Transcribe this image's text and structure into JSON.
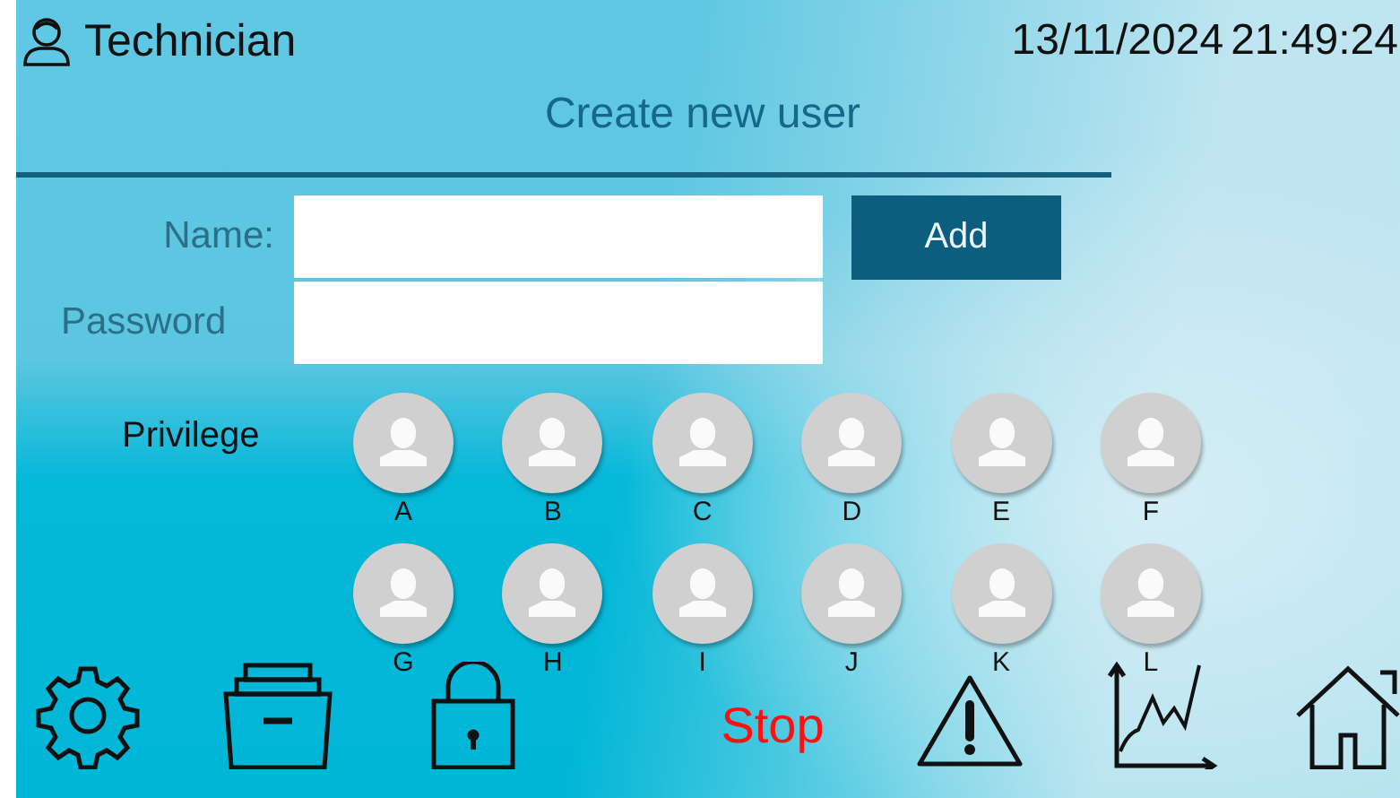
{
  "header": {
    "user": "Technician",
    "date": "13/11/2024",
    "time": "21:49:24"
  },
  "title": "Create new user",
  "form": {
    "fields": [
      {
        "label": "Name:"
      },
      {
        "label": "Password"
      }
    ],
    "add_button": "Add"
  },
  "privilege": {
    "label": "Privilege",
    "users": [
      {
        "label": "A"
      },
      {
        "label": "B"
      },
      {
        "label": "C"
      },
      {
        "label": "D"
      },
      {
        "label": "E"
      },
      {
        "label": "F"
      },
      {
        "label": "G"
      },
      {
        "label": "H"
      },
      {
        "label": "I"
      },
      {
        "label": "J"
      },
      {
        "label": "K"
      },
      {
        "label": "L"
      }
    ]
  },
  "toolbar": [
    {
      "kind": "settings"
    },
    {
      "kind": "archive"
    },
    {
      "kind": "lock"
    },
    {
      "kind": "text",
      "label": "Stop"
    },
    {
      "kind": "warning"
    },
    {
      "kind": "chart"
    },
    {
      "kind": "home"
    }
  ]
}
